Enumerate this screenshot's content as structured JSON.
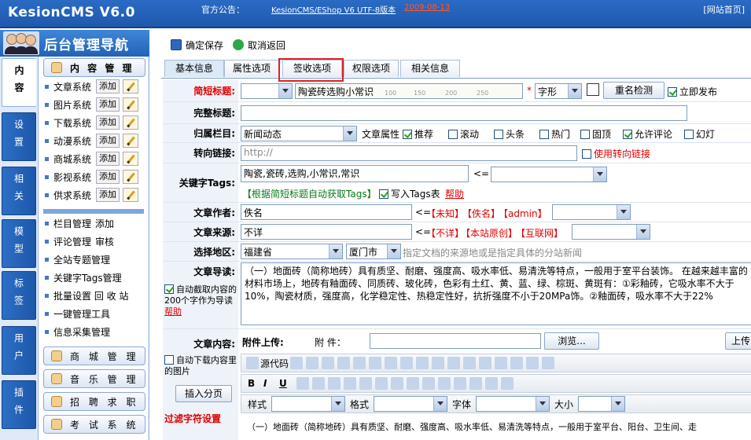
{
  "topbar": {
    "logo": "KesionCMS V6.0",
    "notice_label": "官方公告：",
    "notice_link": "KesionCMS/EShop V6 UTF-8版本",
    "notice_date": "2009-08-13",
    "home_link": "[网站首页]"
  },
  "sidebar": {
    "title": "后台管理导航",
    "vtabs": [
      "内容",
      "设置",
      "相关",
      "模型",
      "标签",
      "用户",
      "插件"
    ],
    "content_group": "内 容 管 理",
    "systems": [
      {
        "label": "文章系统",
        "add": "添加"
      },
      {
        "label": "图片系统",
        "add": "添加"
      },
      {
        "label": "下载系统",
        "add": "添加"
      },
      {
        "label": "动漫系统",
        "add": "添加"
      },
      {
        "label": "商城系统",
        "add": "添加"
      },
      {
        "label": "影视系统",
        "add": "添加"
      },
      {
        "label": "供求系统",
        "add": "添加"
      }
    ],
    "tools": [
      {
        "label": "栏目管理",
        "extra": "添加"
      },
      {
        "label": "评论管理",
        "extra": "审核"
      },
      {
        "label": "全站专题管理",
        "extra": ""
      },
      {
        "label": "关键字Tags管理",
        "extra": ""
      },
      {
        "label": "批量设置 回 收 站",
        "extra": ""
      },
      {
        "label": "一键管理工具",
        "extra": ""
      },
      {
        "label": "信息采集管理",
        "extra": ""
      }
    ],
    "groups": [
      "商 城 管 理",
      "音 乐 管 理",
      "招 聘 求 职",
      "考 试 系 统"
    ]
  },
  "toolbar": {
    "save": "确定保存",
    "cancel": "取消返回"
  },
  "tabs": [
    "基本信息",
    "属性选项",
    "签收选项",
    "权限选项",
    "相关信息"
  ],
  "form": {
    "short_title_label": "简短标题:",
    "short_title_value": "陶瓷砖选购小常识",
    "ruler": [
      "100",
      "150",
      "200",
      "250"
    ],
    "font_select": "字形",
    "check_dup": "重名检测",
    "publish_now": "立即发布",
    "full_title_label": "完整标题:",
    "category_label": "归属栏目:",
    "category_value": "新闻动态",
    "attr_label": "文章属性",
    "attrs": [
      {
        "label": "推荐",
        "checked": true
      },
      {
        "label": "滚动",
        "checked": false
      },
      {
        "label": "头条",
        "checked": false
      },
      {
        "label": "热门",
        "checked": false
      },
      {
        "label": "固顶",
        "checked": false
      },
      {
        "label": "允许评论",
        "checked": true
      },
      {
        "label": "幻灯",
        "checked": false
      }
    ],
    "redirect_label": "转向链接:",
    "redirect_placeholder": "http://",
    "use_redirect": "使用转向链接",
    "tags_label": "关键字Tags:",
    "tags_value": "陶瓷,瓷砖,选购,小常识,常识",
    "arrow": "<=",
    "auto_tags": "【根据简短标题自动获取Tags】",
    "write_tags": "写入Tags表",
    "help": "帮助",
    "author_label": "文章作者:",
    "author_value": "佚名",
    "author_opts": [
      "【未知】",
      "【佚名】",
      "【admin】"
    ],
    "source_label": "文章来源:",
    "source_value": "不详",
    "source_opts": [
      "【不详】",
      "【本站原创】",
      "【互联网】"
    ],
    "region_label": "选择地区:",
    "province": "福建省",
    "city": "厦门市",
    "region_hint": "指定文档的来源地或是指定具体的分站新闻",
    "intro_label": "文章导读:",
    "intro_auto": "自动截取内容的200个字作为导读",
    "intro_text": "（一）地面砖（简称地砖）具有质坚、耐磨、强度高、吸水率低、易清洗等特点，一般用于室平台装饰。    在越来越丰富的材料市场上，地砖有釉面砖、同质砖、玻化砖，色彩有土红、黄、蓝、绿、棕斑、黄斑有：①彩釉砖，它吸水率不大于10%，陶瓷材质，强度高，化学稳定性、热稳定性好，抗折强度不小于20MPa饰。②釉面砖，吸水率不大于22%",
    "content_label": "文章内容:",
    "auto_download": "自动下载内容里的图片",
    "insert_page": "插入分页",
    "filter_label": "过滤字符设置",
    "attach_label": "附件上传:",
    "attach_field": "附 件：",
    "browse": "浏览...",
    "upload": "上传",
    "source_code": "源代码",
    "style_label": "样式",
    "format_label": "格式",
    "font_label": "字体",
    "size_label": "大小",
    "body_text": "（一）地面砖（简称地砖）具有质坚、耐磨、强度高、吸水率低、易清洗等特点，一般用于室平台、阳台、卫生间、走"
  }
}
